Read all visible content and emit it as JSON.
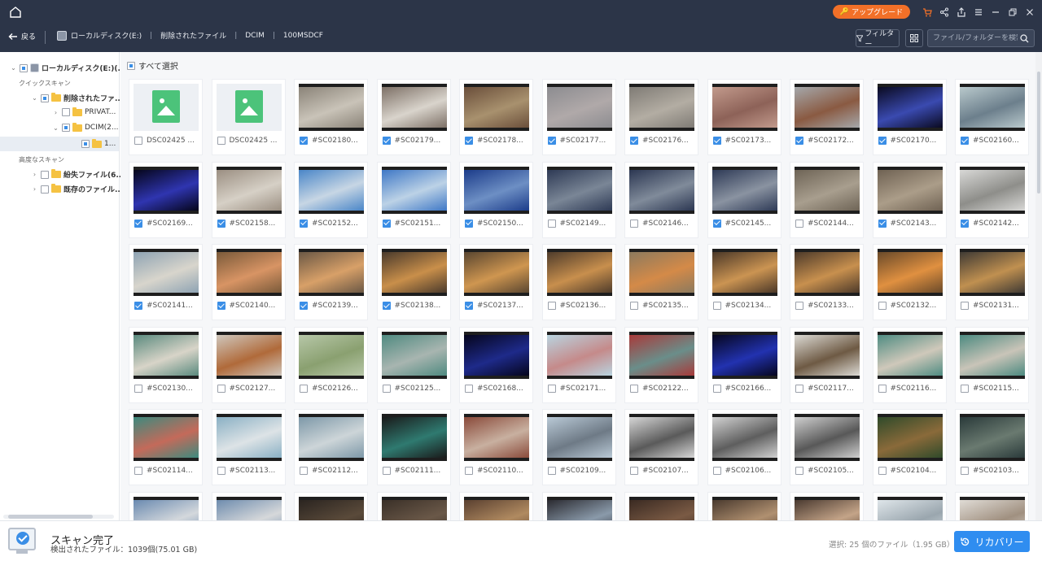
{
  "header": {
    "upgrade_label": "アップグレード",
    "back_label": "戻る",
    "breadcrumbs": [
      "ローカルディスク(E:)",
      "削除されたファイル",
      "DCIM",
      "100MSDCF"
    ],
    "filter_label": "フィルター",
    "search_placeholder": "ファイル/フォルダーを検索",
    "icons": [
      "home-icon",
      "cart-icon",
      "share-icon",
      "export-icon",
      "menu-icon",
      "minimize-icon",
      "restore-icon",
      "close-icon"
    ]
  },
  "sidebar": {
    "root_label": "ローカルディスク(E:)(...",
    "quick_scan_label": "クイックスキャン",
    "deleted_label": "削除されたファ...",
    "private_label": "PRIVAT...",
    "dcim_label": "DCIM(2...",
    "sub_label": "1...",
    "advanced_scan_label": "高度なスキャン",
    "lost_label": "紛失ファイル(6...",
    "existing_label": "既存のファイル..."
  },
  "main": {
    "select_all_label": "すべて選択",
    "files": [
      {
        "name": "DSC02425 ...",
        "checked": false,
        "kind": "placeholder"
      },
      {
        "name": "DSC02425 ...",
        "checked": false,
        "kind": "placeholder"
      },
      {
        "name": "#SC02180...",
        "checked": true,
        "colors": [
          "#8a8378",
          "#c9c3b8"
        ]
      },
      {
        "name": "#SC02179...",
        "checked": true,
        "colors": [
          "#7d7066",
          "#d9d4cc"
        ]
      },
      {
        "name": "#SC02178...",
        "checked": true,
        "colors": [
          "#6a4e3a",
          "#a8916e"
        ]
      },
      {
        "name": "#SC02177...",
        "checked": true,
        "colors": [
          "#8c8c90",
          "#b0a9a9"
        ]
      },
      {
        "name": "#SC02176...",
        "checked": true,
        "colors": [
          "#7f7b75",
          "#b3ada3"
        ]
      },
      {
        "name": "#SC02173...",
        "checked": true,
        "colors": [
          "#c29a8c",
          "#8d6258"
        ]
      },
      {
        "name": "#SC02172...",
        "checked": true,
        "colors": [
          "#a5a8ab",
          "#8a5a42"
        ]
      },
      {
        "name": "#SC02170...",
        "checked": true,
        "colors": [
          "#0a0a20",
          "#3a4ab0"
        ]
      },
      {
        "name": "#SC02160...",
        "checked": true,
        "colors": [
          "#b9c9cc",
          "#6c7f8c"
        ]
      },
      {
        "name": "#SC02169...",
        "checked": true,
        "colors": [
          "#05051a",
          "#2f35b0"
        ]
      },
      {
        "name": "#SC02158...",
        "checked": true,
        "colors": [
          "#9b8f82",
          "#d6d0c6"
        ]
      },
      {
        "name": "#SC02152...",
        "checked": true,
        "colors": [
          "#4a86c8",
          "#c7d6e4"
        ]
      },
      {
        "name": "#SC02151...",
        "checked": true,
        "colors": [
          "#3f78c6",
          "#bcd2e6"
        ]
      },
      {
        "name": "#SC02150...",
        "checked": true,
        "colors": [
          "#1c3c8a",
          "#6d8fc4"
        ]
      },
      {
        "name": "#SC02149...",
        "checked": false,
        "colors": [
          "#2e3a55",
          "#7a8696"
        ]
      },
      {
        "name": "#SC02146...",
        "checked": false,
        "colors": [
          "#2c3752",
          "#808b9a"
        ]
      },
      {
        "name": "#SC02145...",
        "checked": true,
        "colors": [
          "#2e3a56",
          "#8a93a1"
        ]
      },
      {
        "name": "#SC02144...",
        "checked": false,
        "colors": [
          "#6e6456",
          "#a89e8e"
        ]
      },
      {
        "name": "#SC02143...",
        "checked": true,
        "colors": [
          "#6f6253",
          "#ab9d89"
        ]
      },
      {
        "name": "#SC02142...",
        "checked": true,
        "colors": [
          "#d8d8d6",
          "#8e8e8a"
        ]
      },
      {
        "name": "#SC02141...",
        "checked": true,
        "colors": [
          "#8ea3b3",
          "#d8d5cc"
        ]
      },
      {
        "name": "#SC02140...",
        "checked": true,
        "colors": [
          "#7a5a3a",
          "#d89464"
        ]
      },
      {
        "name": "#SC02139...",
        "checked": true,
        "colors": [
          "#6b5845",
          "#d8a068"
        ]
      },
      {
        "name": "#SC02138...",
        "checked": true,
        "colors": [
          "#4a3a2c",
          "#c98f4a"
        ]
      },
      {
        "name": "#SC02137...",
        "checked": true,
        "colors": [
          "#5a4630",
          "#cf9650"
        ]
      },
      {
        "name": "#SC02136...",
        "checked": false,
        "colors": [
          "#4f3c2b",
          "#c88f4d"
        ]
      },
      {
        "name": "#SC02135...",
        "checked": false,
        "colors": [
          "#8c7a5e",
          "#d48a48"
        ]
      },
      {
        "name": "#SC02134...",
        "checked": false,
        "colors": [
          "#4b3828",
          "#cb9452"
        ]
      },
      {
        "name": "#SC02133...",
        "checked": false,
        "colors": [
          "#4d3a2a",
          "#c8904e"
        ]
      },
      {
        "name": "#SC02132...",
        "checked": false,
        "colors": [
          "#6a4a2a",
          "#e09040"
        ]
      },
      {
        "name": "#SC02131...",
        "checked": false,
        "colors": [
          "#3f3a34",
          "#c09050"
        ]
      },
      {
        "name": "#SC02130...",
        "checked": false,
        "colors": [
          "#5a8a7e",
          "#d8d4c8"
        ]
      },
      {
        "name": "#SC02127...",
        "checked": false,
        "colors": [
          "#cfc7bd",
          "#b06a3a"
        ]
      },
      {
        "name": "#SC02126...",
        "checked": false,
        "colors": [
          "#b7c7a8",
          "#8aa070"
        ]
      },
      {
        "name": "#SC02125...",
        "checked": false,
        "colors": [
          "#4f8a80",
          "#a8b5b0"
        ]
      },
      {
        "name": "#SC02168...",
        "checked": false,
        "colors": [
          "#05051c",
          "#1e2a8a"
        ]
      },
      {
        "name": "#SC02171...",
        "checked": false,
        "colors": [
          "#b9d4e0",
          "#c58a8a"
        ]
      },
      {
        "name": "#SC02122...",
        "checked": false,
        "colors": [
          "#a83a3a",
          "#6a8e8a"
        ]
      },
      {
        "name": "#SC02166...",
        "checked": false,
        "colors": [
          "#06061e",
          "#2232b0"
        ]
      },
      {
        "name": "#SC02117...",
        "checked": false,
        "colors": [
          "#dcdad4",
          "#6e5a44"
        ]
      },
      {
        "name": "#SC02116...",
        "checked": false,
        "colors": [
          "#4f8c82",
          "#cfc8ba"
        ]
      },
      {
        "name": "#SC02115...",
        "checked": false,
        "colors": [
          "#4c8a80",
          "#c9c4b8"
        ]
      },
      {
        "name": "#SC02114...",
        "checked": false,
        "colors": [
          "#3d8a7e",
          "#c46a5a"
        ]
      },
      {
        "name": "#SC02113...",
        "checked": false,
        "colors": [
          "#8ab0c4",
          "#dde3e6"
        ]
      },
      {
        "name": "#SC02112...",
        "checked": false,
        "colors": [
          "#7d98a8",
          "#cdd5d8"
        ]
      },
      {
        "name": "#SC02111...",
        "checked": false,
        "colors": [
          "#1a1a1a",
          "#2f7a70"
        ]
      },
      {
        "name": "#SC02110...",
        "checked": false,
        "colors": [
          "#8a4a3a",
          "#c8b0a0"
        ]
      },
      {
        "name": "#SC02109...",
        "checked": false,
        "colors": [
          "#b9c9d6",
          "#6e7a86"
        ]
      },
      {
        "name": "#SC02107...",
        "checked": false,
        "colors": [
          "#d6d6d6",
          "#5a5a5a"
        ]
      },
      {
        "name": "#SC02106...",
        "checked": false,
        "colors": [
          "#d2d2d2",
          "#5e5e5e"
        ]
      },
      {
        "name": "#SC02105...",
        "checked": false,
        "colors": [
          "#cfcfcf",
          "#585858"
        ]
      },
      {
        "name": "#SC02104...",
        "checked": false,
        "colors": [
          "#2f4a2a",
          "#8a6a3a"
        ]
      },
      {
        "name": "#SC02103...",
        "checked": false,
        "colors": [
          "#2a3a3a",
          "#6a7a70"
        ]
      },
      {
        "name": "",
        "checked": false,
        "colors": [
          "#6a8ab0",
          "#d4d8dc"
        ]
      },
      {
        "name": "",
        "checked": false,
        "colors": [
          "#6e8cae",
          "#d6d8da"
        ]
      },
      {
        "name": "",
        "checked": false,
        "colors": [
          "#2a2420",
          "#5a4a3a"
        ]
      },
      {
        "name": "",
        "checked": false,
        "colors": [
          "#3a3028",
          "#6a5848"
        ]
      },
      {
        "name": "",
        "checked": false,
        "colors": [
          "#5a4030",
          "#b08a60"
        ]
      },
      {
        "name": "",
        "checked": false,
        "colors": [
          "#2a2a30",
          "#8a9aaa"
        ]
      },
      {
        "name": "",
        "checked": false,
        "colors": [
          "#3a2a22",
          "#7a5a44"
        ]
      },
      {
        "name": "",
        "checked": false,
        "colors": [
          "#4a3a2e",
          "#b09070"
        ]
      },
      {
        "name": "",
        "checked": false,
        "colors": [
          "#4a3a30",
          "#c4a488"
        ]
      },
      {
        "name": "",
        "checked": false,
        "colors": [
          "#dfe6ea",
          "#9aa6ae"
        ]
      },
      {
        "name": "",
        "checked": false,
        "colors": [
          "#e0dcd6",
          "#a09080"
        ]
      }
    ]
  },
  "footer": {
    "status_title": "スキャン完了",
    "status_sub": "検出されたファイル：1039個(75.01 GB)",
    "selection_info": "選択: 25 個のファイル（1.95 GB）",
    "recover_label": "リカバリー"
  },
  "colors": {
    "header_bg": "#2c3548",
    "accent": "#2f8df0",
    "upgrade": "#f27028",
    "folder": "#f5c242"
  }
}
